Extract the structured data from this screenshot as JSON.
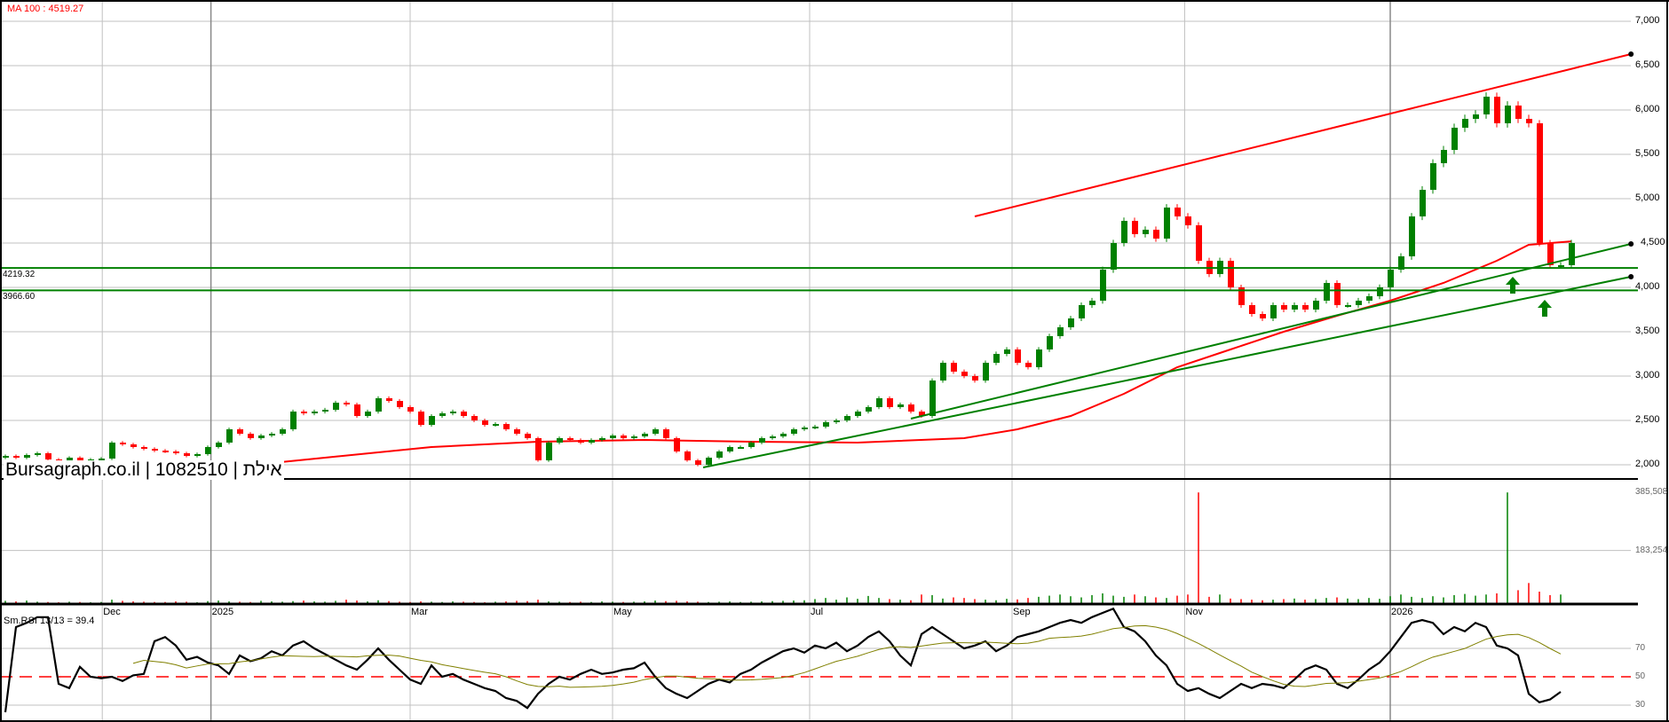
{
  "header": {
    "ma_label": "MA 100 : 4519.27",
    "rsi_label": "Sm.RSI 13/13 = 39.4"
  },
  "watermark": {
    "site": "Bursagraph.co.il",
    "sep1": " | ",
    "security_id": "1082510",
    "sep2": " | ",
    "name": "אילת"
  },
  "colors": {
    "up": "#008000",
    "down": "#ff0000",
    "ma": "#ff0000",
    "signal": "#808000",
    "grid": "#c0c0c0"
  },
  "chart_data": {
    "type": "candlestick",
    "price_axis": {
      "ticks": [
        2000,
        2500,
        3000,
        3500,
        4000,
        4500,
        5000,
        5500,
        6000,
        6500,
        7000
      ],
      "tick_labels": [
        "2,000",
        "2,500",
        "3,000",
        "3,500",
        "4,000",
        "4,500",
        "5,000",
        "5,500",
        "6,000",
        "6,500",
        "7,000"
      ],
      "range": [
        1840,
        7240
      ]
    },
    "x_ticks": [
      {
        "label": "Dec",
        "index": 9.1,
        "year": false
      },
      {
        "label": "2025",
        "index": 19.3,
        "year": true
      },
      {
        "label": "Mar",
        "index": 38,
        "year": false
      },
      {
        "label": "May",
        "index": 57,
        "year": false
      },
      {
        "label": "Jul",
        "index": 75.5,
        "year": false
      },
      {
        "label": "Sep",
        "index": 94.5,
        "year": false
      },
      {
        "label": "Nov",
        "index": 110.7,
        "year": false
      },
      {
        "label": "2026",
        "index": 130,
        "year": true
      }
    ],
    "closes": [
      2100,
      2080,
      2110,
      2130,
      2060,
      2050,
      2080,
      2050,
      2060,
      2070,
      2250,
      2230,
      2200,
      2180,
      2160,
      2150,
      2130,
      2100,
      2120,
      2200,
      2250,
      2400,
      2350,
      2300,
      2330,
      2350,
      2400,
      2600,
      2580,
      2600,
      2620,
      2700,
      2680,
      2550,
      2600,
      2750,
      2720,
      2650,
      2600,
      2450,
      2550,
      2580,
      2600,
      2550,
      2500,
      2450,
      2460,
      2400,
      2350,
      2300,
      2050,
      2250,
      2300,
      2280,
      2250,
      2280,
      2300,
      2330,
      2300,
      2320,
      2350,
      2400,
      2300,
      2150,
      2050,
      2000,
      2080,
      2150,
      2200,
      2200,
      2250,
      2300,
      2320,
      2350,
      2400,
      2420,
      2430,
      2480,
      2500,
      2550,
      2600,
      2650,
      2750,
      2650,
      2680,
      2600,
      2550,
      2950,
      3150,
      3050,
      3000,
      2950,
      3150,
      3250,
      3300,
      3150,
      3100,
      3300,
      3450,
      3550,
      3650,
      3800,
      3850,
      4200,
      4500,
      4750,
      4600,
      4650,
      4550,
      4900,
      4800,
      4700,
      4300,
      4150,
      4300,
      4000,
      3800,
      3700,
      3650,
      3800,
      3750,
      3800,
      3750,
      3850,
      4050,
      3800,
      3800,
      3850,
      3900,
      4000,
      4200,
      4350,
      4800,
      5100,
      5400,
      5550,
      5800,
      5900,
      5950,
      6150,
      5850,
      6050,
      5900,
      5850,
      4500,
      4250,
      4250,
      4500
    ],
    "ma100": {
      "name": "MA 100",
      "last": 4519.27,
      "points": [
        [
          0,
          1880
        ],
        [
          10,
          1900
        ],
        [
          20,
          1960
        ],
        [
          30,
          2080
        ],
        [
          40,
          2200
        ],
        [
          50,
          2260
        ],
        [
          60,
          2280
        ],
        [
          70,
          2260
        ],
        [
          80,
          2250
        ],
        [
          90,
          2300
        ],
        [
          95,
          2400
        ],
        [
          100,
          2550
        ],
        [
          105,
          2800
        ],
        [
          110,
          3100
        ],
        [
          115,
          3300
        ],
        [
          120,
          3500
        ],
        [
          125,
          3680
        ],
        [
          130,
          3850
        ],
        [
          135,
          4050
        ],
        [
          140,
          4300
        ],
        [
          143,
          4480
        ],
        [
          147,
          4519
        ]
      ]
    },
    "levels": [
      {
        "value": 4219.32,
        "label": "4219.32"
      },
      {
        "value": 3966.6,
        "label": "3966.60"
      }
    ],
    "trendlines": [
      {
        "name": "resistance",
        "color": "#ff0000",
        "from": [
          91,
          4800
        ],
        "to": [
          152.6,
          6630
        ]
      },
      {
        "name": "support-upper",
        "color": "#008000",
        "from": [
          85,
          2520
        ],
        "to": [
          152.6,
          4490
        ]
      },
      {
        "name": "support-lower",
        "color": "#008000",
        "from": [
          65.5,
          1970
        ],
        "to": [
          152.6,
          4120
        ]
      }
    ],
    "arrows": [
      {
        "index": 141.5,
        "price": 4120
      },
      {
        "index": 144.5,
        "price": 3860
      }
    ],
    "volume": {
      "tick_values": [
        183254,
        385508
      ],
      "tick_labels": [
        "183,254",
        "385,508"
      ],
      "max": 440000,
      "values": [
        8000,
        6000,
        9000,
        5000,
        4000,
        3000,
        5000,
        4000,
        3000,
        4000,
        12000,
        8000,
        6000,
        5000,
        4000,
        4000,
        6000,
        5000,
        3000,
        7000,
        9000,
        6000,
        5000,
        4000,
        8000,
        6000,
        5000,
        7000,
        9000,
        6000,
        5000,
        8000,
        12000,
        9000,
        6000,
        10000,
        7000,
        5000,
        4000,
        6000,
        5000,
        4000,
        6000,
        5000,
        4000,
        3000,
        5000,
        6000,
        8000,
        7000,
        12000,
        6000,
        5000,
        4000,
        5000,
        4000,
        6000,
        5000,
        4000,
        5000,
        6000,
        9000,
        7000,
        8000,
        6000,
        5000,
        4000,
        5000,
        6000,
        4000,
        5000,
        6000,
        7000,
        8000,
        9000,
        10000,
        14000,
        18000,
        12000,
        20000,
        15000,
        25000,
        18000,
        14000,
        12000,
        10000,
        30000,
        28000,
        16000,
        20000,
        18000,
        14000,
        12000,
        10000,
        15000,
        13000,
        18000,
        22000,
        26000,
        30000,
        24000,
        20000,
        28000,
        34000,
        26000,
        22000,
        30000,
        24000,
        20000,
        18000,
        26000,
        30000,
        385000,
        22000,
        30000,
        16000,
        14000,
        12000,
        10000,
        12000,
        14000,
        16000,
        12000,
        14000,
        18000,
        20000,
        16000,
        14000,
        18000,
        15000,
        24000,
        30000,
        22000,
        18000,
        24000,
        20000,
        28000,
        32000,
        26000,
        30000,
        34000,
        385000,
        45000,
        70000,
        40000,
        28000,
        30000
      ]
    },
    "rsi": {
      "name": "Sm.RSI 13/13",
      "last": 39.4,
      "levels": [
        30,
        50,
        70
      ],
      "level_labels": [
        "30",
        "50",
        "70"
      ],
      "signal_period": 13,
      "values": [
        25,
        85,
        88,
        92,
        92,
        45,
        42,
        57,
        50,
        49,
        50,
        47,
        51,
        52,
        75,
        78,
        72,
        62,
        64,
        60,
        58,
        52,
        65,
        61,
        63,
        68,
        65,
        72,
        75,
        70,
        66,
        62,
        58,
        55,
        62,
        70,
        62,
        55,
        48,
        45,
        58,
        50,
        52,
        48,
        45,
        42,
        40,
        35,
        33,
        28,
        38,
        45,
        50,
        48,
        52,
        55,
        52,
        53,
        55,
        56,
        60,
        50,
        42,
        38,
        35,
        40,
        45,
        48,
        46,
        52,
        55,
        60,
        64,
        68,
        70,
        67,
        72,
        70,
        74,
        68,
        72,
        78,
        82,
        75,
        65,
        58,
        80,
        85,
        80,
        75,
        70,
        72,
        75,
        68,
        72,
        78,
        80,
        82,
        85,
        88,
        90,
        88,
        92,
        95,
        98,
        85,
        82,
        75,
        65,
        58,
        45,
        40,
        42,
        38,
        35,
        40,
        45,
        42,
        45,
        44,
        42,
        48,
        55,
        58,
        55,
        45,
        42,
        48,
        55,
        60,
        68,
        78,
        88,
        90,
        88,
        80,
        85,
        82,
        88,
        85,
        72,
        70,
        65,
        38,
        32,
        34,
        39.4
      ]
    }
  }
}
